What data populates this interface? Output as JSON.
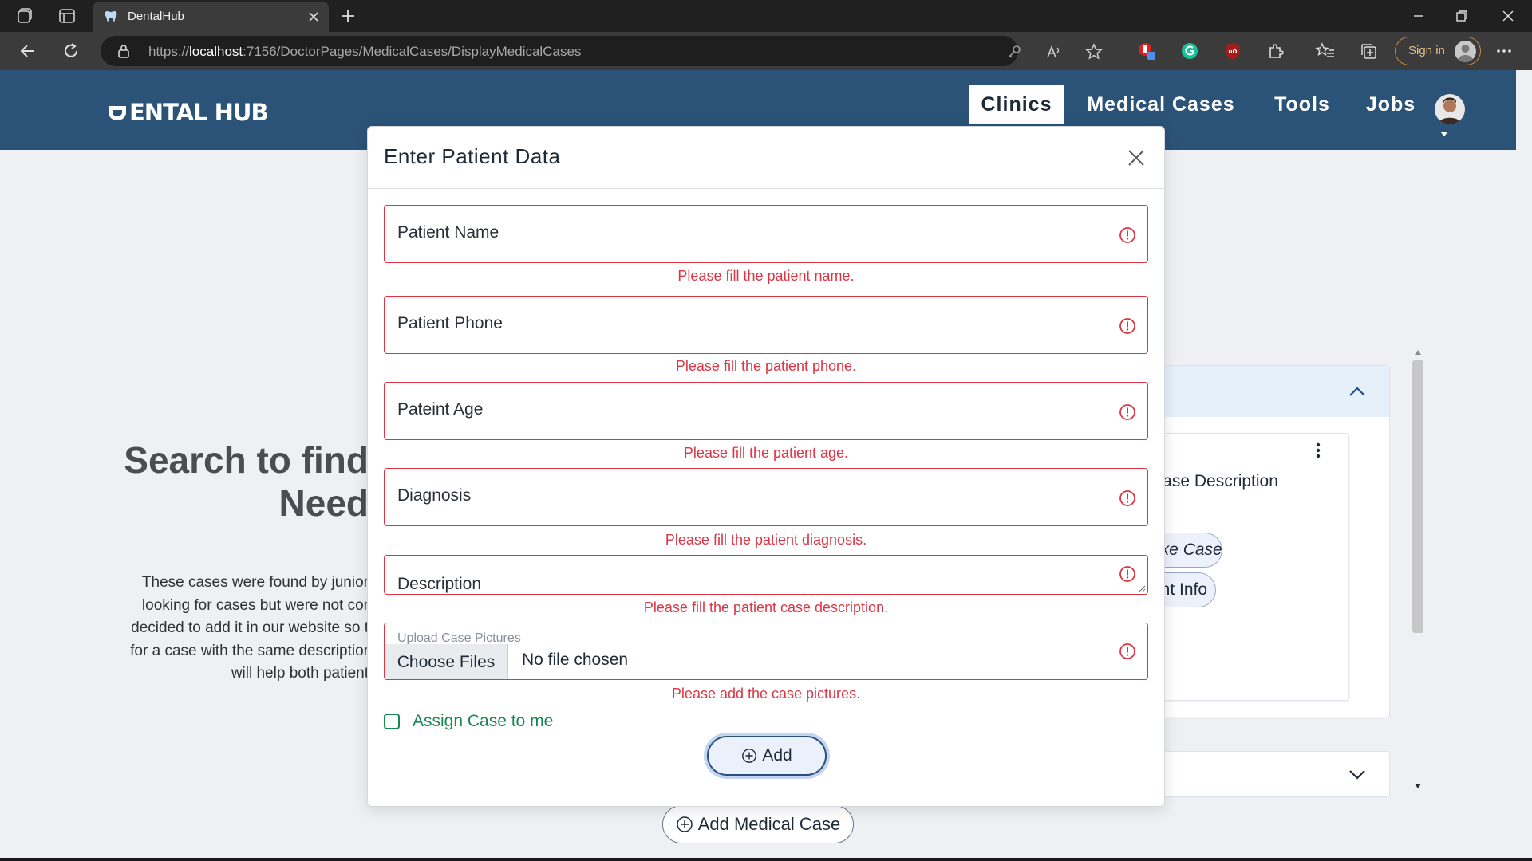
{
  "browser": {
    "tab_title": "DentalHub",
    "url_prefix": "https://",
    "url_host": "localhost",
    "url_path": ":7156/DoctorPages/MedicalCases/DisplayMedicalCases",
    "signin_label": "Sign in"
  },
  "site": {
    "logo_text": "ENTAL HUB",
    "nav": {
      "clinics": "Clinics",
      "medical_cases": "Medical Cases",
      "tools": "Tools",
      "jobs": "Jobs"
    },
    "header_color": "#2b5378"
  },
  "background": {
    "heading_line1": "Search to find",
    "heading_line2": "Need",
    "para_line1": "These cases were found by junior",
    "para_line2": "looking for cases but were not cor",
    "para_line3": "decided to add it in our website so t",
    "para_line4": "for a case with the same descriptior",
    "para_line5": "will help both patient",
    "card_title": "Case Description",
    "pill_take_case": "ake Case",
    "pill_patient_info": "ent Info",
    "add_medical_case": "Add Medical Case"
  },
  "modal": {
    "title": "Enter Patient Data",
    "fields": {
      "patient_name": {
        "label": "Patient Name",
        "error": "Please fill the patient name."
      },
      "patient_phone": {
        "label": "Patient Phone",
        "error": "Please fill the patient phone."
      },
      "patient_age": {
        "label": "Pateint Age",
        "error": "Please fill the patient age."
      },
      "diagnosis": {
        "label": "Diagnosis",
        "error": "Please fill the patient diagnosis."
      },
      "description": {
        "label": "Description",
        "error": "Please fill the patient case description."
      },
      "pictures": {
        "label": "Upload Case Pictures",
        "button": "Choose Files",
        "status": "No file chosen",
        "error": "Please add the case pictures."
      }
    },
    "assign_label": "Assign Case to me",
    "assign_checked": false,
    "add_button": "Add",
    "error_color": "#dc3545",
    "success_color": "#198754"
  }
}
